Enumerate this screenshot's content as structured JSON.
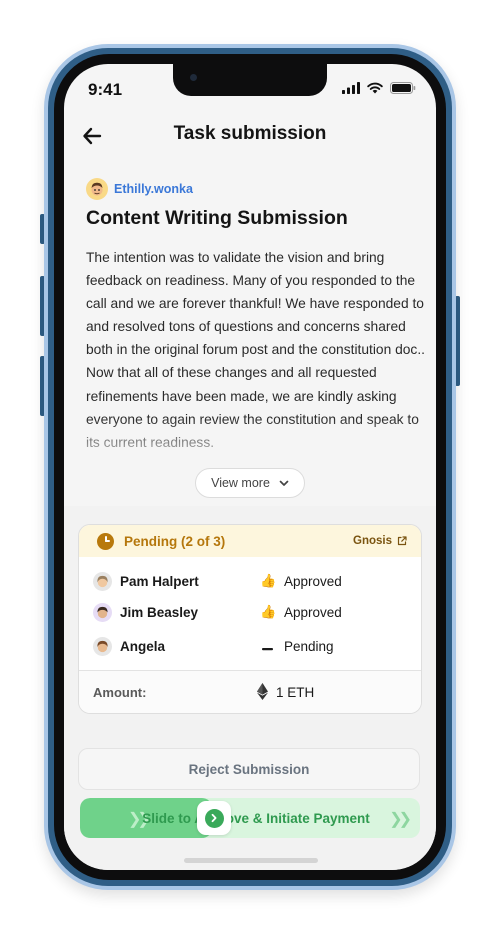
{
  "status_bar": {
    "time": "9:41"
  },
  "header": {
    "title": "Task submission"
  },
  "submission": {
    "author": "Ethilly.wonka",
    "title": "Content Writing Submission",
    "paragraph1": "The intention was to validate the vision and bring feedback on readiness. Many of you responded to the call and we are forever thankful! We have responded to and resolved tons of questions and concerns shared both in the original forum post and the constitution doc..",
    "paragraph2": "Now that all of these changes and all requested refinements have been made, we are kindly asking everyone to again review the constitution and speak to its current readiness.",
    "view_more_label": "View more"
  },
  "approval": {
    "status_label": "Pending (2 of 3)",
    "safe_link_label": "Gnosis",
    "reviewers": [
      {
        "name": "Pam Halpert",
        "status": "Approved",
        "status_icon": "thumbs-up-icon"
      },
      {
        "name": "Jim Beasley",
        "status": "Approved",
        "status_icon": "thumbs-up-icon"
      },
      {
        "name": "Angela",
        "status": "Pending",
        "status_icon": "dash-icon"
      }
    ],
    "amount_label": "Amount:",
    "amount_value": "1 ETH"
  },
  "actions": {
    "reject_label": "Reject Submission",
    "slide_label": "Slide to Approve & Initiate Payment"
  },
  "colors": {
    "accent_blue": "#3b78d8",
    "pending_amber": "#b5770c",
    "approve_green": "#3aa95a",
    "frame_blue": "#2f5e86"
  }
}
